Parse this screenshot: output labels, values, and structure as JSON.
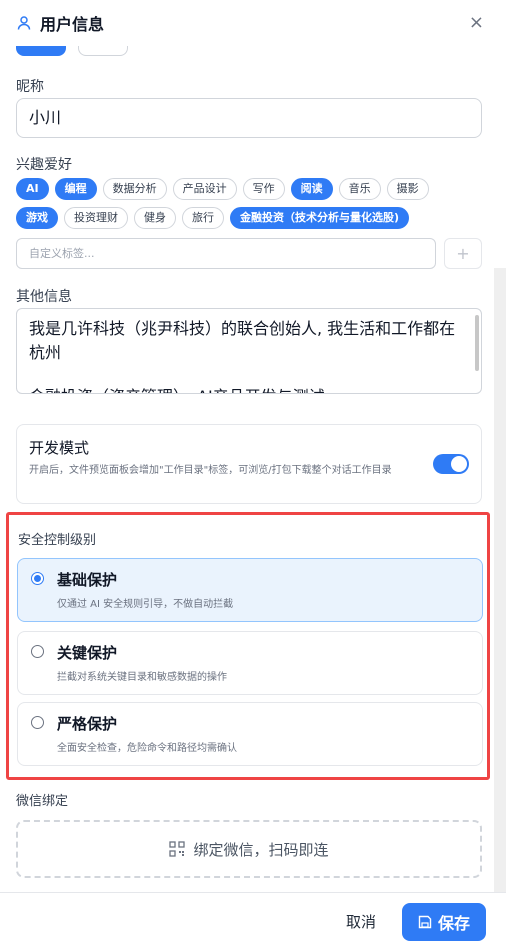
{
  "header": {
    "title": "用户信息",
    "close_glyph": "×",
    "icon": "user-icon"
  },
  "nickname": {
    "label": "昵称",
    "value": "小川"
  },
  "interests": {
    "label": "兴趣爱好",
    "tags_row1": [
      {
        "label": "AI",
        "selected": true
      },
      {
        "label": "编程",
        "selected": true
      },
      {
        "label": "数据分析",
        "selected": false
      },
      {
        "label": "产品设计",
        "selected": false
      },
      {
        "label": "写作",
        "selected": false
      },
      {
        "label": "阅读",
        "selected": true
      },
      {
        "label": "音乐",
        "selected": false
      },
      {
        "label": "摄影",
        "selected": false
      }
    ],
    "tags_row2": [
      {
        "label": "游戏",
        "selected": true
      },
      {
        "label": "投资理财",
        "selected": false
      },
      {
        "label": "健身",
        "selected": false
      },
      {
        "label": "旅行",
        "selected": false
      },
      {
        "label": "金融投资（技术分析与量化选股)",
        "selected": true
      }
    ],
    "custom_placeholder": "自定义标签...",
    "add_glyph": "+"
  },
  "other_info": {
    "label": "其他信息",
    "line1": "我是几许科技（兆尹科技）的联合创始人, 我生活和工作都在杭州",
    "line2": "金融投资（资产管理）、AI产品开发与测试"
  },
  "dev_mode": {
    "title": "开发模式",
    "description": "开启后，文件预览面板会增加\"工作目录\"标签，可浏览/打包下载整个对话工作目录",
    "enabled": true
  },
  "security": {
    "title": "安全控制级别",
    "options": [
      {
        "title": "基础保护",
        "desc": "仅通过 AI 安全规则引导，不做自动拦截",
        "selected": true
      },
      {
        "title": "关键保护",
        "desc": "拦截对系统关键目录和敏感数据的操作",
        "selected": false
      },
      {
        "title": "严格保护",
        "desc": "全面安全检查，危险命令和路径均需确认",
        "selected": false
      }
    ]
  },
  "wechat": {
    "label": "微信绑定",
    "button": "绑定微信，扫码即连",
    "icon": "qrcode-icon"
  },
  "footer": {
    "cancel": "取消",
    "save": "保存",
    "save_icon": "save-icon"
  },
  "colors": {
    "accent": "#2f7bf5",
    "highlight_border": "#ef4444",
    "selected_bg": "#eaf3fd"
  }
}
